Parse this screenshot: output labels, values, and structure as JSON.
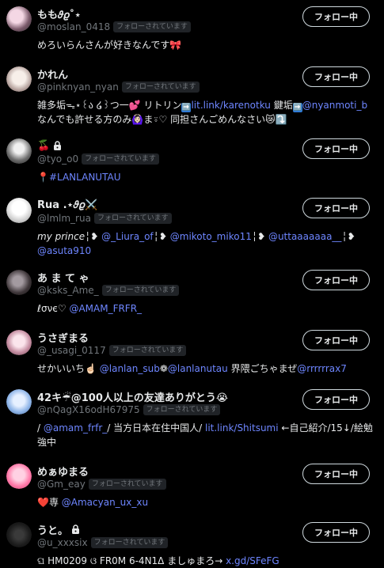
{
  "follow_button_label": "フォロー中",
  "follows_you_label": "フォローされています",
  "colors": {
    "link": "#6e86ff",
    "handle": "#71767b",
    "background": "#000000",
    "text": "#e7e9ea"
  },
  "users": [
    {
      "name": "もも𝜗𝜚˚⋆",
      "handle": "@moslan_0418",
      "locked": false,
      "name_suffix": "",
      "bio": [
        {
          "t": "めろいらんさんが好きなんです🎀"
        }
      ]
    },
    {
      "name": "かれん",
      "handle": "@pinknyan_nyan",
      "locked": false,
      "name_suffix": "",
      "bio": [
        {
          "t": "雑多垢ᯓ⋆꒰ა ໒꒱つ一💕 リトリン"
        },
        {
          "t": "➡️",
          "icon": "right-arrow-icon"
        },
        {
          "t": "lit.link/karenotku",
          "link": true
        },
        {
          "t": " 鍵垢"
        },
        {
          "t": "➡️",
          "icon": "right-arrow-icon"
        },
        {
          "t": "@nyanmoti_b",
          "link": true
        },
        {
          "t": " なんでも許せる方のみ🙆🏻‍♀️ま⍤♡ 同担さんごめんなさい😿⤵️"
        }
      ]
    },
    {
      "name": "🍒",
      "handle": "@tyo_o0",
      "locked": true,
      "name_suffix": "",
      "bio": [
        {
          "t": "📍"
        },
        {
          "t": "#LANLANUTAU",
          "link": true
        }
      ]
    },
    {
      "name": "Rua .⋆𝜗𝜚⚔️",
      "handle": "@lmlm_rua",
      "locked": false,
      "name_suffix": "",
      "bio": [
        {
          "t": "my prince",
          "italic": true
        },
        {
          "t": "╎❥ "
        },
        {
          "t": "@_Liura_of",
          "link": true
        },
        {
          "t": "╎❥ "
        },
        {
          "t": "@mikoto_miko11",
          "link": true
        },
        {
          "t": "╎❥ "
        },
        {
          "t": "@uttaaaaaaa__",
          "link": true
        },
        {
          "t": "╎❥ "
        },
        {
          "t": "@asuta910",
          "link": true
        }
      ]
    },
    {
      "name": "あ ま て ゃ",
      "handle": "@ksks_Ame_",
      "locked": false,
      "name_suffix": "",
      "bio": [
        {
          "t": "ℓσνє♡ "
        },
        {
          "t": "@AMAM_FRFR_",
          "link": true
        }
      ]
    },
    {
      "name": "うさぎまる",
      "handle": "@_usagi_0117",
      "locked": false,
      "name_suffix": "",
      "bio": [
        {
          "t": "せかいいち☝🏻 "
        },
        {
          "t": "@lanlan_sub",
          "link": true
        },
        {
          "t": "❁"
        },
        {
          "t": "@lanlanutau",
          "link": true
        },
        {
          "t": " 界隈ごちゃまぜ"
        },
        {
          "t": "@rrrrrrax7",
          "link": true
        }
      ]
    },
    {
      "name": "42キ☔@100人以上の友達ありがとう😭",
      "handle": "@nQagX16odH67975",
      "locked": false,
      "name_suffix": "",
      "bio": [
        {
          "t": "/ "
        },
        {
          "t": "@amam_frfr_",
          "link": true
        },
        {
          "t": "/ 当方日本在住中国人/ "
        },
        {
          "t": "lit.link/Shitsumi",
          "link": true
        },
        {
          "t": " ←自己紹介/15↓/絵勉強中"
        }
      ]
    },
    {
      "name": "めぁゆまる",
      "handle": "@Gm_eay",
      "locked": false,
      "name_suffix": "",
      "bio": [
        {
          "t": "❤️専 "
        },
        {
          "t": "@Amacyan_ux_xu",
          "link": true
        }
      ]
    },
    {
      "name": "うと。",
      "handle": "@u_xxxsix",
      "locked": true,
      "name_suffix": "",
      "bio": [
        {
          "t": "ଘ HM0209 ଓ FR0M 6-4N1Δ ましゅまろ→ "
        },
        {
          "t": "x.gd/SFeFG",
          "link": true
        }
      ]
    }
  ]
}
